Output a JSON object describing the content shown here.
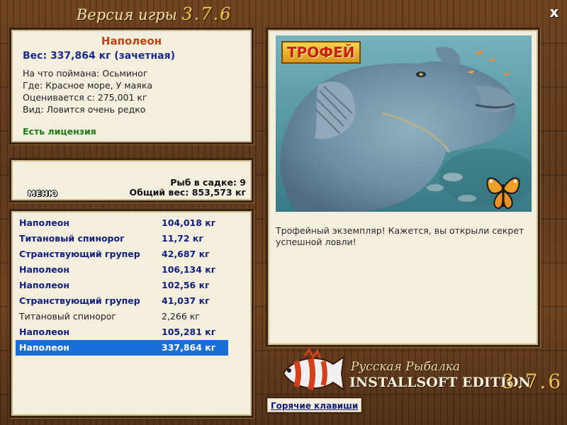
{
  "window": {
    "title_prefix": "Версия игры",
    "title_version": "3.7.6",
    "close_label": "x"
  },
  "fish": {
    "name": "Наполеон",
    "weight": "Вес: 337,864 кг (зачетная)",
    "bait": "На что поймана: Осьминог",
    "location": "Где: Красное море, У маяка",
    "valued": "Оценивается с: 275,001 кг",
    "rarity": "Вид: Ловится очень редко",
    "license": "Есть лицензия"
  },
  "stats": {
    "menu_label": "МЕНЮ",
    "fish_count": "Рыб в садке: 9",
    "total_weight": "Общий вес: 853,573 кг"
  },
  "catch_list": [
    {
      "name": "Наполеон",
      "weight": "104,018 кг",
      "style": "bold"
    },
    {
      "name": "Титановый спинорог",
      "weight": "11,72 кг",
      "style": "bold"
    },
    {
      "name": "Странствующий групер",
      "weight": "42,687 кг",
      "style": "bold"
    },
    {
      "name": "Наполеон",
      "weight": "106,134 кг",
      "style": "bold"
    },
    {
      "name": "Наполеон",
      "weight": "102,56 кг",
      "style": "bold"
    },
    {
      "name": "Странствующий групер",
      "weight": "41,037 кг",
      "style": "bold"
    },
    {
      "name": "Титановый спинорог",
      "weight": "2,266 кг",
      "style": "normal"
    },
    {
      "name": "Наполеон",
      "weight": "105,281 кг",
      "style": "bold"
    },
    {
      "name": "Наполеон",
      "weight": "337,864 кг",
      "style": "selected"
    }
  ],
  "photo": {
    "badge": "ТРОФЕЙ"
  },
  "description": "Трофейный экземпляр! Кажется, вы открыли секрет успешной ловли!",
  "logo": {
    "title": "Русская Рыбалка",
    "edition": "INSTALLSOFT EDITION",
    "version": "3.7.6"
  },
  "hotkeys_label": "Горячие клавиши",
  "colors": {
    "accent_name": "#c5420c",
    "list_bold": "#11207c",
    "selected_bg": "#1a6ed8",
    "license": "#1f7a16"
  }
}
